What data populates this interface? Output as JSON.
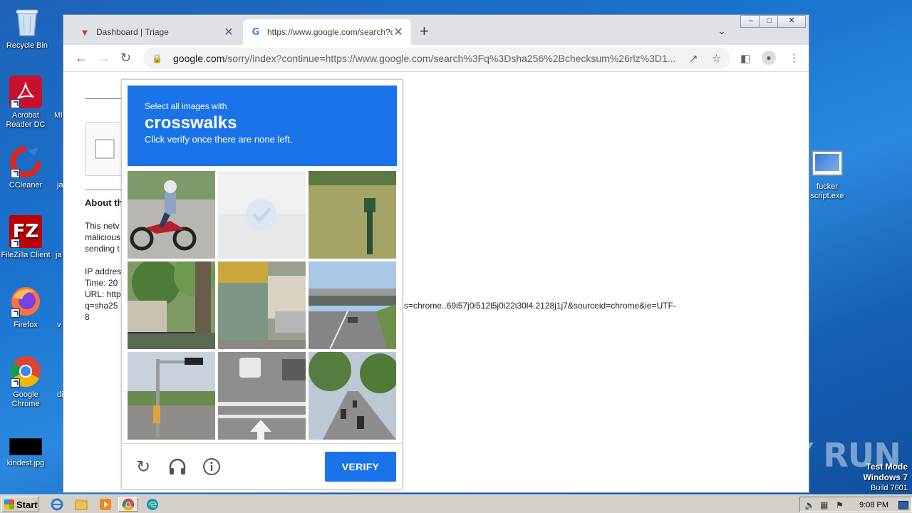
{
  "desktop": {
    "icons": [
      {
        "label": "Recycle Bin"
      },
      {
        "label": "Acrobat Reader DC"
      },
      {
        "label": "CCleaner"
      },
      {
        "label": "FileZilla Client"
      },
      {
        "label": "Firefox"
      },
      {
        "label": "Google Chrome"
      },
      {
        "label": "kindest.jpg"
      },
      {
        "label": "fucker script.exe"
      }
    ],
    "partial_labels": [
      "Mi",
      "ja",
      "ja",
      "v",
      "di"
    ]
  },
  "browser": {
    "tabs": [
      {
        "title": "Dashboard | Triage",
        "favicon": "triage-icon"
      },
      {
        "title": "https://www.google.com/search?q=",
        "favicon": "google-icon"
      }
    ],
    "address": {
      "host": "google.com",
      "path": "/sorry/index?continue=https://www.google.com/search%3Fq%3Dsha256%2Bchecksum%26rlz%3D1..."
    }
  },
  "page": {
    "about_heading": "About th",
    "para_lines": [
      "This netv",
      "malicious",
      "sending t"
    ],
    "info_lines": [
      "IP addres",
      "Time: 20",
      "URL: http",
      "q=sha25"
    ],
    "url_tail": "s=chrome..69i57j0i512l5j0i22i30l4.2128j1j7&sourceid=chrome&ie=UTF-",
    "url_tail2": "8"
  },
  "captcha": {
    "instruction_line1": "Select all images with",
    "target": "crosswalks",
    "instruction_line3": "Click verify once there are none left.",
    "verify_label": "VERIFY",
    "tiles": [
      "motorcycle-rider",
      "faded-loading",
      "mailbox-on-grass",
      "tree-and-fence",
      "street-shops",
      "highway-overpass",
      "traffic-light-street",
      "road-with-cars",
      "motorcycles-on-road"
    ]
  },
  "watermark": {
    "text": "ANY RUN"
  },
  "os_info": {
    "line1": "Test Mode",
    "line2": "Windows 7",
    "line3": "Build 7601"
  },
  "taskbar": {
    "start_label": "Start",
    "time": "9:08 PM"
  }
}
